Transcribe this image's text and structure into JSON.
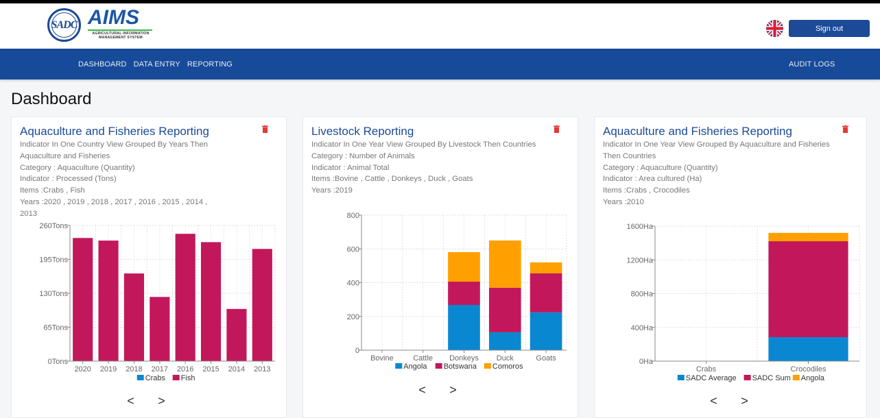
{
  "header": {
    "logo_seal_text": "SADC",
    "brand_name": "AIMS",
    "brand_subtitle_line1": "AGRICULTURAL INFORMATION",
    "brand_subtitle_line2": "MANAGEMENT SYSTEM",
    "language_flag": "uk-flag-icon",
    "sign_out_label": "Sign out"
  },
  "nav": {
    "items": [
      {
        "label": "DASHBOARD"
      },
      {
        "label": "DATA ENTRY"
      },
      {
        "label": "REPORTING"
      }
    ],
    "audit_logs_label": "AUDIT LOGS"
  },
  "page": {
    "title": "Dashboard"
  },
  "colors": {
    "primary": "#1c4a96",
    "series_blue": "#0a87d1",
    "series_crimson": "#c2185b",
    "series_orange": "#ffa000",
    "delete_red": "#e53935"
  },
  "cards": [
    {
      "title": "Aquaculture and Fisheries Reporting",
      "meta_line1": "Indicator In One Country View Grouped By Years Then",
      "meta_line2": "Aquaculture and Fisheries",
      "category": "Category : Aquaculture (Quantity)",
      "indicator": "Indicator : Processed (Tons)",
      "items": "Items :Crabs , Fish",
      "years": "Years :2020 , 2019 , 2018 , 2017 , 2016 , 2015 , 2014 , 2013",
      "prev": "<",
      "next": ">"
    },
    {
      "title": "Livestock Reporting",
      "meta_line1": "Indicator In One Year View Grouped By Livestock Then Countries",
      "category": "Category : Number of Animals",
      "indicator": "Indicator : Animal Total",
      "items": "Items :Bovine , Cattle , Donkeys , Duck , Goats",
      "years": "Years :2019",
      "prev": "<",
      "next": ">"
    },
    {
      "title": "Aquaculture and Fisheries Reporting",
      "meta_line1": "Indicator In One Year View Grouped By Aquaculture and Fisheries",
      "meta_line2": "Then Countries",
      "category": "Category : Aquaculture (Quantity)",
      "indicator": "Indicator : Area cultured (Ha)",
      "items": "Items :Crabs , Crocodiles",
      "years": "Years :2010",
      "prev": "<",
      "next": ">"
    }
  ],
  "chart_data": [
    {
      "type": "bar",
      "stacked": true,
      "title": "",
      "categories": [
        "2020",
        "2019",
        "2018",
        "2017",
        "2016",
        "2015",
        "2014",
        "2013"
      ],
      "series": [
        {
          "name": "Crabs",
          "color": "#0a87d1",
          "values": [
            0,
            0,
            0,
            0,
            0,
            0,
            0,
            0
          ]
        },
        {
          "name": "Fish",
          "color": "#c2185b",
          "values": [
            236,
            231,
            168,
            123,
            244,
            228,
            100,
            215
          ]
        }
      ],
      "yticks": [
        0,
        65,
        130,
        195,
        260
      ],
      "ytick_suffix": "Tons",
      "ylim": [
        0,
        260
      ],
      "grid": true,
      "legend": "bottom"
    },
    {
      "type": "bar",
      "stacked": true,
      "title": "",
      "categories": [
        "Bovine",
        "Cattle",
        "Donkeys",
        "Duck",
        "Goats"
      ],
      "series": [
        {
          "name": "Angola",
          "color": "#0a87d1",
          "values": [
            0,
            0,
            268,
            106,
            224
          ]
        },
        {
          "name": "Botswana",
          "color": "#c2185b",
          "values": [
            0,
            0,
            138,
            264,
            231
          ]
        },
        {
          "name": "Comoros",
          "color": "#ffa000",
          "values": [
            0,
            0,
            175,
            280,
            65
          ]
        }
      ],
      "yticks": [
        0,
        200,
        400,
        600,
        800
      ],
      "ytick_suffix": "",
      "ylim": [
        0,
        800
      ],
      "grid": true,
      "legend": "bottom"
    },
    {
      "type": "bar",
      "stacked": true,
      "title": "",
      "categories": [
        "Crabs",
        "Crocodiles"
      ],
      "series": [
        {
          "name": "SADC Average",
          "color": "#0a87d1",
          "values": [
            0,
            284
          ]
        },
        {
          "name": "SADC Sum",
          "color": "#c2185b",
          "values": [
            0,
            1137
          ]
        },
        {
          "name": "Angola",
          "color": "#ffa000",
          "values": [
            0,
            99
          ]
        }
      ],
      "yticks": [
        0,
        400,
        800,
        1200,
        1600
      ],
      "ytick_suffix": "Ha",
      "ylim": [
        0,
        1600
      ],
      "grid": true,
      "legend": "bottom"
    }
  ]
}
